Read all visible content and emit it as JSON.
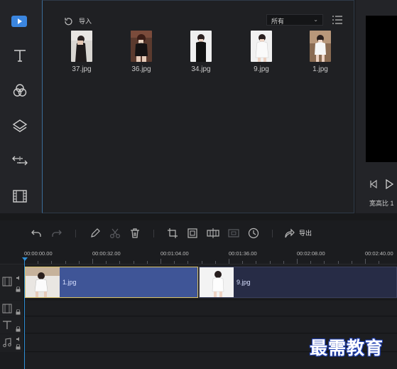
{
  "media_panel": {
    "import_label": "导入",
    "filter_value": "所有",
    "items": [
      {
        "label": "37.jpg"
      },
      {
        "label": "36.jpg"
      },
      {
        "label": "34.jpg"
      },
      {
        "label": "9.jpg"
      },
      {
        "label": "1.jpg"
      }
    ]
  },
  "sidebar": {
    "items": [
      {
        "icon": "media-icon"
      },
      {
        "icon": "text-icon"
      },
      {
        "icon": "filter-icon"
      },
      {
        "icon": "overlay-icon"
      },
      {
        "icon": "transition-icon"
      },
      {
        "icon": "film-icon"
      }
    ]
  },
  "preview": {
    "aspect_label": "宽高比 1"
  },
  "toolbar": {
    "export_label": "导出",
    "icons": [
      "undo-icon",
      "redo-icon",
      "edit-icon",
      "cut-icon",
      "delete-icon",
      "crop-icon",
      "zoom-fit-icon",
      "split-icon",
      "mosaic-icon",
      "duration-icon",
      "export-icon"
    ]
  },
  "ruler": {
    "labels": [
      "00:00:00.00",
      "00:00:32.00",
      "00:01:04.00",
      "00:01:36.00",
      "00:02:08.00",
      "00:02:40.00"
    ]
  },
  "timeline": {
    "clips": [
      {
        "label": "1.jpg"
      },
      {
        "label": "9.jpg"
      }
    ]
  },
  "watermark": "最需教育",
  "colors": {
    "accent": "#3b86e0",
    "playhead": "#2f8fd6",
    "clip_selected": "#3f5597",
    "clip": "#272c46"
  }
}
